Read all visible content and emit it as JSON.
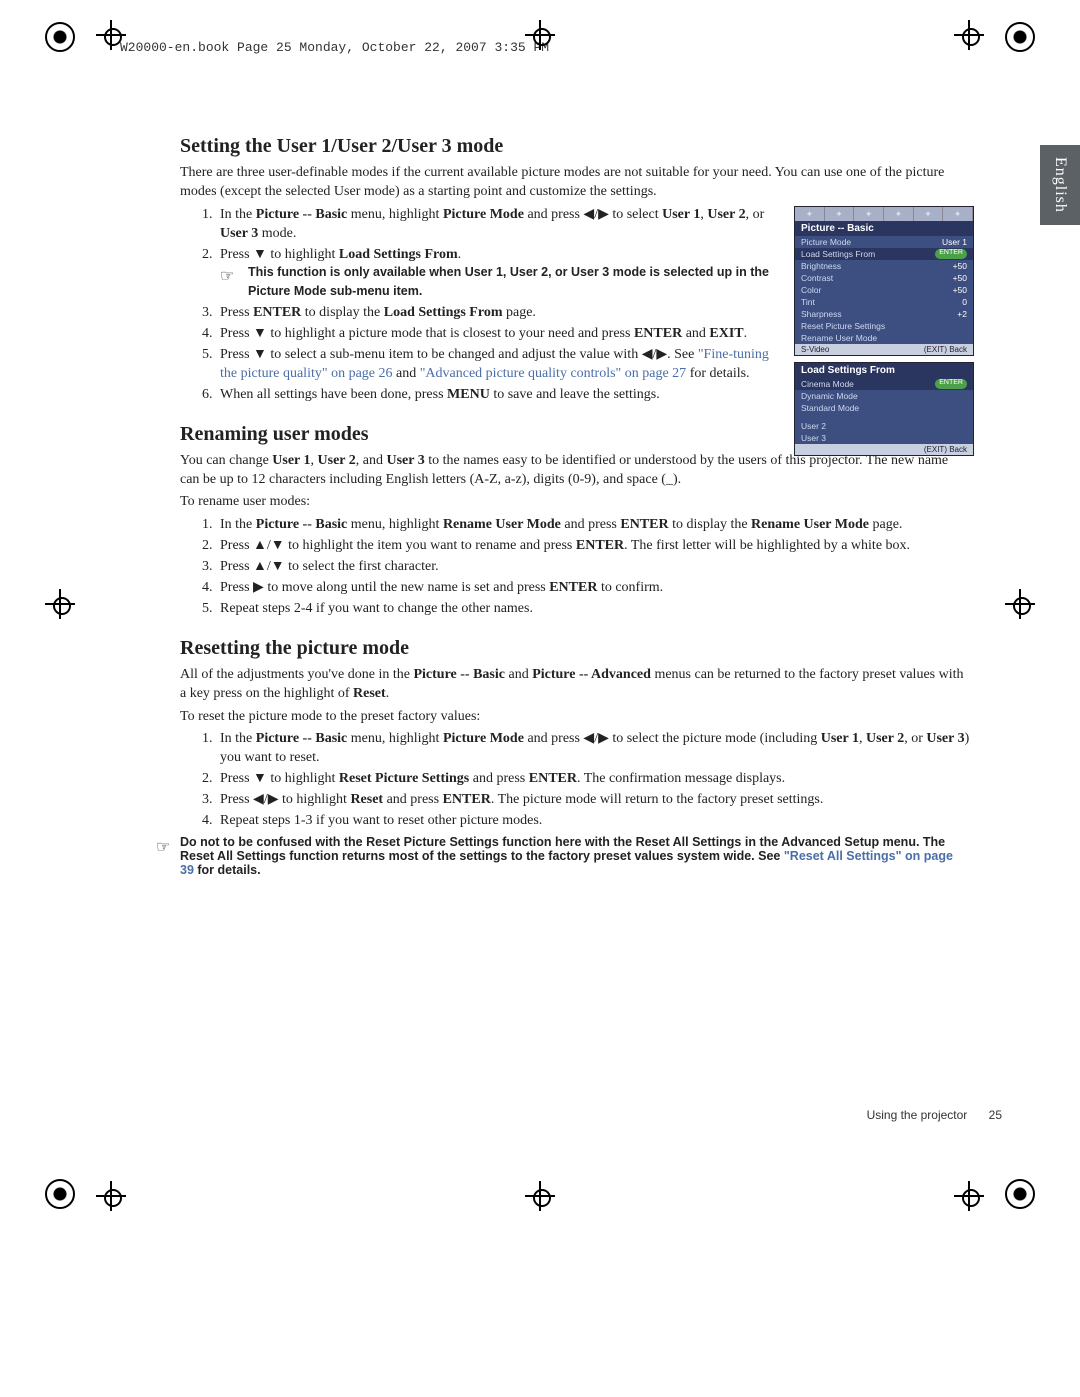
{
  "header_stamp": "W20000-en.book  Page 25  Monday, October 22, 2007  3:35 PM",
  "language_tab": "English",
  "section1": {
    "heading": "Setting the User 1/User 2/User 3 mode",
    "intro": "There are three user-definable modes if the current available picture modes are not suitable for your need. You can use one of the picture modes (except the selected User mode) as a starting point and customize the settings.",
    "step1_a": "In the ",
    "step1_b": "Picture -- Basic",
    "step1_c": " menu, highlight ",
    "step1_d": "Picture Mode",
    "step1_e": " and press ◀/▶ to select ",
    "step1_f": "User 1",
    "step1_g": ", ",
    "step1_h": "User 2",
    "step1_i": ", or ",
    "step1_j": "User 3",
    "step1_k": " mode.",
    "step2_a": "Press ▼ to highlight ",
    "step2_b": "Load Settings From",
    "step2_c": ".",
    "note1": "This function is only available when User 1, User 2, or User 3 mode is selected up in the Picture Mode sub-menu item.",
    "step3_a": "Press ",
    "step3_b": "ENTER",
    "step3_c": " to display the ",
    "step3_d": "Load Settings From",
    "step3_e": " page.",
    "step4_a": "Press ▼ to highlight a picture mode that is closest to your need and press ",
    "step4_b": "ENTER",
    "step4_c": " and ",
    "step4_d": "EXIT",
    "step4_e": ".",
    "step5_a": "Press ▼ to select a sub-menu item to be changed and adjust the value with ◀/▶. See ",
    "step5_link1": "\"Fine-tuning the picture quality\" on page 26",
    "step5_b": " and ",
    "step5_link2": "\"Advanced picture quality controls\" on page 27",
    "step5_c": " for details.",
    "step6_a": "When all settings have been done, press ",
    "step6_b": "MENU",
    "step6_c": " to save and leave the settings."
  },
  "osd1": {
    "title": "Picture -- Basic",
    "rows": [
      {
        "label": "Picture Mode",
        "val": "User 1"
      },
      {
        "label": "Load Settings From",
        "val": "ENTER"
      },
      {
        "label": "Brightness",
        "val": "+50"
      },
      {
        "label": "Contrast",
        "val": "+50"
      },
      {
        "label": "Color",
        "val": "+50"
      },
      {
        "label": "Tint",
        "val": "0"
      },
      {
        "label": "Sharpness",
        "val": "+2"
      },
      {
        "label": "Reset Picture Settings",
        "val": ""
      },
      {
        "label": "Rename User Mode",
        "val": ""
      }
    ],
    "footer_left": "S-Video",
    "footer_right": "(EXIT) Back"
  },
  "osd2": {
    "title": "Load Settings From",
    "rows": [
      {
        "label": "Cinema Mode",
        "val": "ENTER"
      },
      {
        "label": "Dynamic Mode",
        "val": ""
      },
      {
        "label": "Standard Mode",
        "val": ""
      },
      {
        "label": "User 2",
        "val": ""
      },
      {
        "label": "User 3",
        "val": ""
      }
    ],
    "footer_right": "(EXIT) Back"
  },
  "section2": {
    "heading": "Renaming user modes",
    "intro_a": "You can change ",
    "intro_b": "User 1",
    "intro_c": ", ",
    "intro_d": "User 2",
    "intro_e": ", and ",
    "intro_f": "User 3",
    "intro_g": " to the names easy to be identified or understood by the users of this projector. The new name can be up to 12 characters including English letters (A-Z, a-z), digits (0-9), and space (_).",
    "lead": "To rename user modes:",
    "s1_a": "In the ",
    "s1_b": "Picture -- Basic",
    "s1_c": " menu, highlight ",
    "s1_d": "Rename User Mode",
    "s1_e": " and press ",
    "s1_f": "ENTER",
    "s1_g": " to display the ",
    "s1_h": "Rename User Mode",
    "s1_i": " page.",
    "s2_a": "Press ▲/▼ to highlight the item you want to rename and press ",
    "s2_b": "ENTER",
    "s2_c": ". The first letter will be highlighted by a white box.",
    "s3": "Press ▲/▼ to select the first character.",
    "s4_a": "Press ▶ to move along until the new name is set and press ",
    "s4_b": "ENTER",
    "s4_c": " to confirm.",
    "s5": "Repeat steps 2-4 if you want to change the other names."
  },
  "section3": {
    "heading": "Resetting the picture mode",
    "intro_a": "All of the adjustments you've done in the ",
    "intro_b": "Picture -- Basic",
    "intro_c": " and ",
    "intro_d": "Picture -- Advanced",
    "intro_e": " menus can be returned to the factory preset values with a key press on the highlight of ",
    "intro_f": "Reset",
    "intro_g": ".",
    "lead": "To reset the picture mode to the preset factory values:",
    "s1_a": "In the ",
    "s1_b": "Picture -- Basic",
    "s1_c": " menu, highlight ",
    "s1_d": "Picture Mode",
    "s1_e": " and press ◀/▶ to select the picture mode (including ",
    "s1_f": "User 1",
    "s1_g": ", ",
    "s1_h": "User 2",
    "s1_i": ", or ",
    "s1_j": "User 3",
    "s1_k": ") you want to reset.",
    "s2_a": "Press ▼ to highlight ",
    "s2_b": "Reset Picture Settings",
    "s2_c": " and press ",
    "s2_d": "ENTER",
    "s2_e": ". The confirmation message displays.",
    "s3_a": "Press ◀/▶ to highlight ",
    "s3_b": "Reset",
    "s3_c": " and press ",
    "s3_d": "ENTER",
    "s3_e": ". The picture mode will return to the factory preset settings.",
    "s4": "Repeat steps 1-3 if you want to reset other picture modes.",
    "note_a": "Do not to be confused with the Reset Picture Settings function here with the Reset All Settings in the Advanced Setup menu. The Reset All Settings function returns most of the settings to the factory preset values system wide. See ",
    "note_link": "\"Reset All Settings\" on page 39",
    "note_b": " for details."
  },
  "footer": {
    "label": "Using the projector",
    "page": "25"
  }
}
